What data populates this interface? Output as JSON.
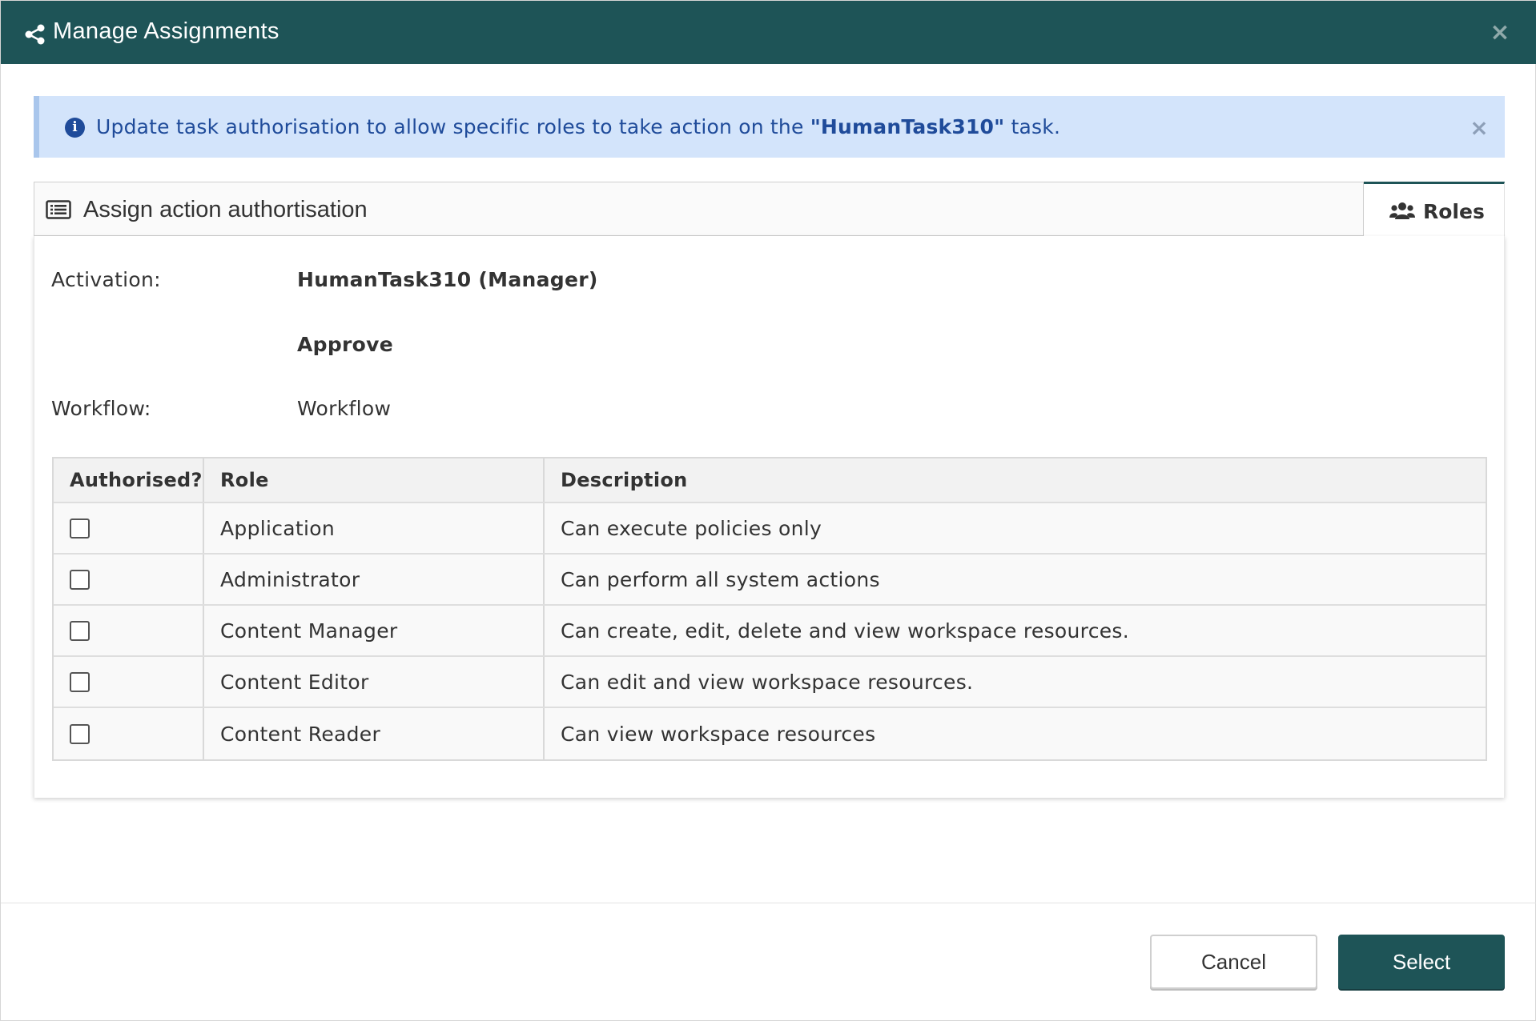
{
  "header": {
    "title": "Manage Assignments",
    "icon": "share-nodes-icon",
    "close": "×"
  },
  "alert": {
    "text_before": "Update task authorisation to allow specific roles to take action on the ",
    "task_name": "\"HumanTask310\"",
    "text_after": " task.",
    "info_glyph": "i",
    "close": "×"
  },
  "section": {
    "title": "Assign action authortisation",
    "tab_label": "Roles"
  },
  "details": {
    "activation_label": "Activation:",
    "activation_value": "HumanTask310 (Manager)",
    "action_value": "Approve",
    "workflow_label": "Workflow:",
    "workflow_value": "Workflow"
  },
  "table": {
    "columns": [
      "Authorised?",
      "Role",
      "Description"
    ],
    "rows": [
      {
        "authorised": false,
        "role": "Application",
        "description": "Can execute policies only"
      },
      {
        "authorised": false,
        "role": "Administrator",
        "description": "Can perform all system actions"
      },
      {
        "authorised": false,
        "role": "Content Manager",
        "description": "Can create, edit, delete and view workspace resources."
      },
      {
        "authorised": false,
        "role": "Content Editor",
        "description": "Can edit and view workspace resources."
      },
      {
        "authorised": false,
        "role": "Content Reader",
        "description": "Can view workspace resources"
      }
    ]
  },
  "footer": {
    "cancel_label": "Cancel",
    "select_label": "Select"
  },
  "colors": {
    "header_bg": "#1e5457",
    "alert_bg": "#d3e4fb",
    "alert_text": "#1f4b9a",
    "primary_button": "#1e5457"
  }
}
